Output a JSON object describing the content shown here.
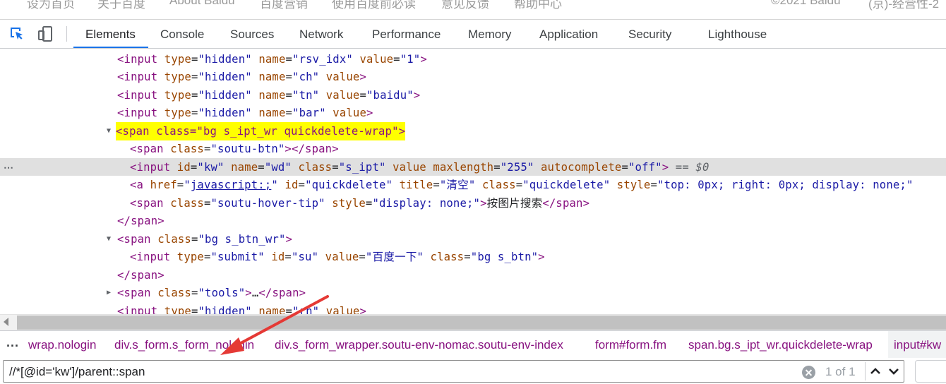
{
  "page_footer": {
    "links": [
      "设为首页",
      "关于百度",
      "About Baidu",
      "百度营销",
      "使用百度前必读",
      "意见反馈",
      "帮助中心"
    ],
    "copyright": "©2021 Baidu",
    "icp": "(京)-经营性-2"
  },
  "toolbar": {
    "inspect_icon": "select-element-icon",
    "device_icon": "device-toggle-icon",
    "tabs": [
      "Elements",
      "Console",
      "Sources",
      "Network",
      "Performance",
      "Memory",
      "Application",
      "Security",
      "Lighthouse"
    ],
    "active_tab": "Elements",
    "accent_color": "#1a73e8"
  },
  "dom_lines": [
    {
      "tag_open": "<input",
      "a1_name": "type",
      "a1_val": "\"hidden\"",
      "a2_name": "name",
      "a2_val": "\"rsv_idx\"",
      "a3_name": "value",
      "a3_val": "\"1\"",
      "tag_close": ">"
    },
    {
      "tag_open": "<input",
      "a1_name": "type",
      "a1_val": "\"hidden\"",
      "a2_name": "name",
      "a2_val": "\"ch\"",
      "a3_name": "value",
      "tag_close": ">"
    },
    {
      "tag_open": "<input",
      "a1_name": "type",
      "a1_val": "\"hidden\"",
      "a2_name": "name",
      "a2_val": "\"tn\"",
      "a3_name": "value",
      "a3_val": "\"baidu\"",
      "tag_close": ">"
    },
    {
      "tag_open": "<input",
      "a1_name": "type",
      "a1_val": "\"hidden\"",
      "a2_name": "name",
      "a2_val": "\"bar\"",
      "a3_name": "value",
      "tag_close": ">"
    },
    {
      "full": "<span class=\"bg s_ipt_wr quickdelete-wrap\">"
    },
    {
      "tag_open": "<span",
      "a1_name": "class",
      "a1_val": "\"soutu-btn\"",
      "tag_close": "></span>"
    },
    {
      "tag_open": "<input",
      "a1_name": "id",
      "a1_val": "\"kw\"",
      "a2_name": "name",
      "a2_val": "\"wd\"",
      "a3_name": "class",
      "a3_val": "\"s_ipt\"",
      "a4_name": "value",
      "a5_name": "maxlength",
      "a5_val": "\"255\"",
      "a6_name": "autocomplete",
      "a6_val": "\"off\"",
      "tag_close": ">",
      "dollar": " == ",
      "dollar_var": "$0"
    },
    {
      "tag_open": "<a",
      "a1_name": "href",
      "a1_q1": "\"",
      "a1_link": "javascript:;",
      "a1_q2": "\"",
      "a2_name": "id",
      "a2_val": "\"quickdelete\"",
      "a3_name": "title",
      "a3_val": "\"清空\"",
      "a4_name": "class",
      "a4_val": "\"quickdelete\"",
      "a5_name": "style",
      "a5_val": "\"top: 0px; right: 0px; display: none;\""
    },
    {
      "tag_open": "<span",
      "a1_name": "class",
      "a1_val": "\"soutu-hover-tip\"",
      "a2_name": "style",
      "a2_val": "\"display: none;\"",
      "tag_close": ">",
      "text": "按图片搜索",
      "end_tag": "</span>"
    },
    {
      "end_tag": "</span>"
    },
    {
      "tag_open": "<span",
      "a1_name": "class",
      "a1_val": "\"bg s_btn_wr\"",
      "tag_close": ">"
    },
    {
      "tag_open": "<input",
      "a1_name": "type",
      "a1_val": "\"submit\"",
      "a2_name": "id",
      "a2_val": "\"su\"",
      "a3_name": "value",
      "a3_val": "\"百度一下\"",
      "a4_name": "class",
      "a4_val": "\"bg s_btn\"",
      "tag_close": ">"
    },
    {
      "end_tag": "</span>"
    },
    {
      "tag_open": "<span",
      "a1_name": "class",
      "a1_val": "\"tools\"",
      "tag_close": ">",
      "text": "…",
      "end_tag": "</span>"
    },
    {
      "tag_open": "<input",
      "a1_name": "type",
      "a1_val": "\"hidden\"",
      "a2_name": "name",
      "a2_val": "\"rn\"",
      "a3_name": "value",
      "tag_close": ">"
    }
  ],
  "breadcrumbs": {
    "overflow": "...",
    "items": [
      "wrap.nologin",
      "div.s_form.s_form_nologin",
      "div.s_form_wrapper.soutu-env-nomac.soutu-env-index",
      "form#form.fm",
      "span.bg.s_ipt_wr.quickdelete-wrap",
      "input#kw"
    ]
  },
  "search": {
    "value": "//*[@id='kw']/parent::span",
    "match_count": "1 of 1",
    "clear_icon": "clear-circle-icon",
    "prev_icon": "chevron-up-icon",
    "next_icon": "chevron-down-icon"
  },
  "annotation": {
    "color": "#e53935"
  }
}
